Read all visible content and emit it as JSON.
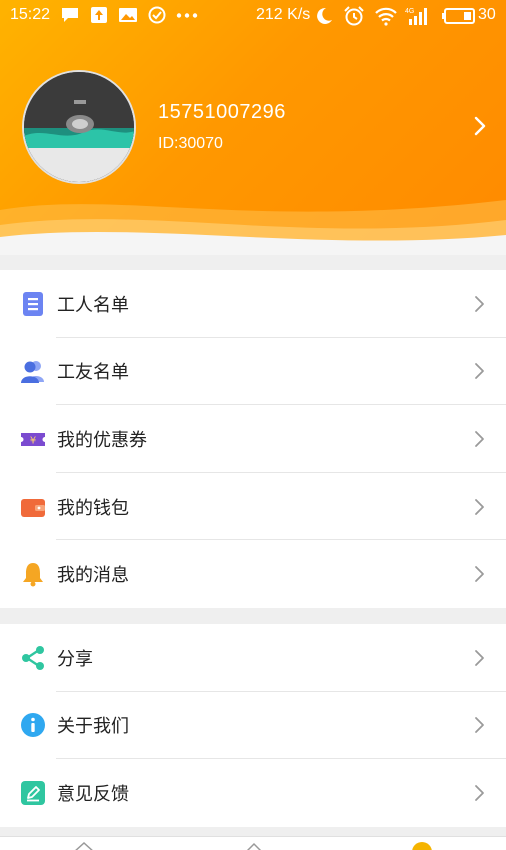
{
  "status_bar": {
    "time": "15:22",
    "speed": "212 K/s",
    "battery": "30",
    "icons": [
      "message-icon",
      "upload-icon",
      "gallery-icon",
      "check-circle-icon",
      "more-dots-icon",
      "moon-icon",
      "alarm-icon",
      "wifi-icon",
      "signal-4g-icon",
      "battery-icon"
    ]
  },
  "profile": {
    "phone": "15751007296",
    "id_text": "ID:30070"
  },
  "menu_group1": [
    {
      "label": "工人名单",
      "icon": "document-list-icon",
      "color": "#5b7cf0"
    },
    {
      "label": "工友名单",
      "icon": "users-icon",
      "color": "#4a6ee0"
    },
    {
      "label": "我的优惠券",
      "icon": "coupon-icon",
      "color": "#7b4bd0"
    },
    {
      "label": "我的钱包",
      "icon": "wallet-icon",
      "color": "#f06a3a"
    },
    {
      "label": "我的消息",
      "icon": "bell-icon",
      "color": "#f5a623"
    }
  ],
  "menu_group2": [
    {
      "label": "分享",
      "icon": "share-icon",
      "color": "#2fc6a0"
    },
    {
      "label": "关于我们",
      "icon": "info-icon",
      "color": "#2fa8f0"
    },
    {
      "label": "意见反馈",
      "icon": "feedback-icon",
      "color": "#2fc6a0"
    }
  ],
  "colors": {
    "header_start": "#ffb300",
    "header_end": "#ff8a00",
    "background": "#efefef"
  }
}
